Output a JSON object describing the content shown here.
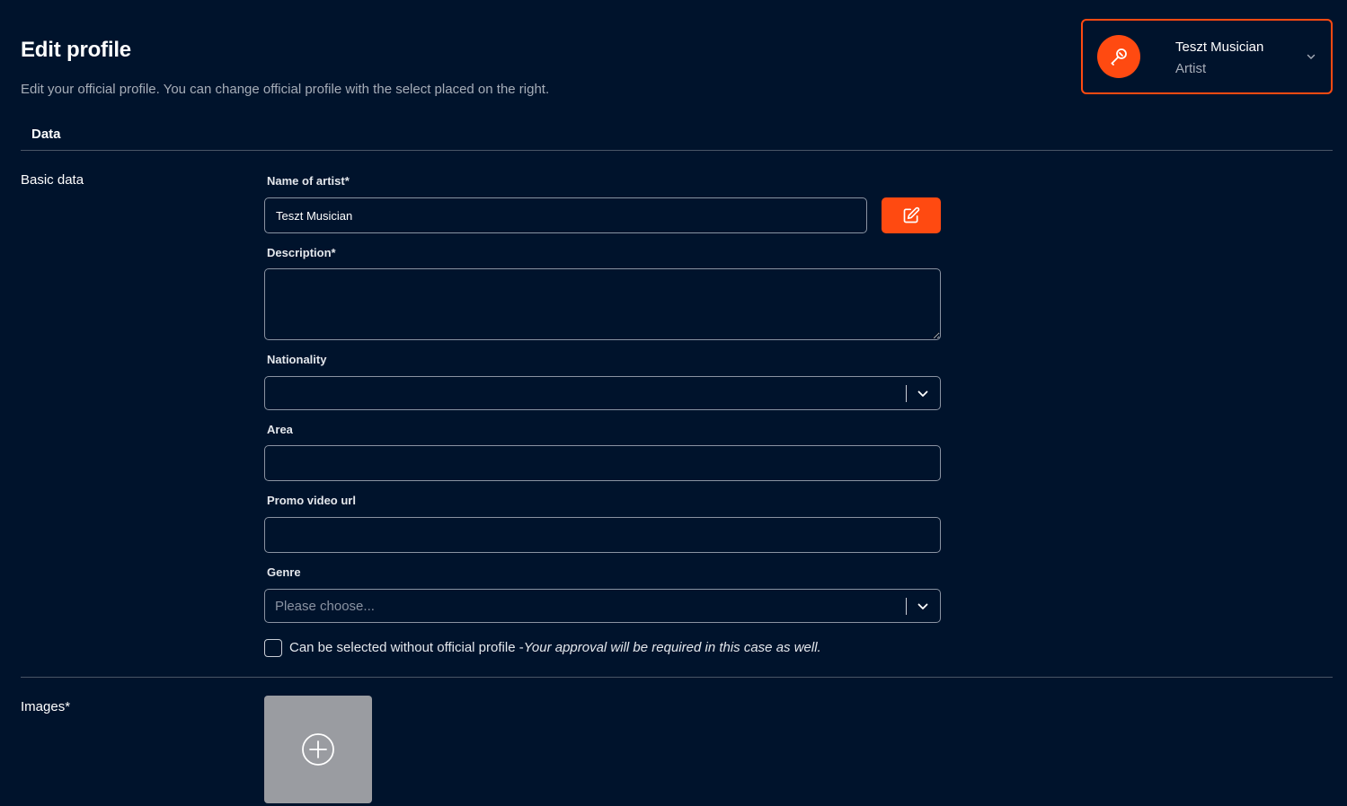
{
  "header": {
    "title": "Edit profile",
    "subtitle": "Edit your official profile. You can change official profile with the select placed on the right."
  },
  "profile_selector": {
    "name": "Teszt Musician",
    "role": "Artist",
    "avatar_icon": "microphone-icon",
    "accent_color": "#ff4a11"
  },
  "tabs": [
    {
      "label": "Data"
    }
  ],
  "sections": {
    "basic_data": "Basic data",
    "images": "Images*"
  },
  "form": {
    "name_label": "Name of artist*",
    "name_value": "Teszt Musician",
    "edit_icon": "edit-icon",
    "description_label": "Description*",
    "description_value": "",
    "nationality_label": "Nationality",
    "nationality_value": "",
    "area_label": "Area",
    "area_value": "",
    "promo_label": "Promo video url",
    "promo_value": "",
    "genre_label": "Genre",
    "genre_placeholder": "Please choose...",
    "checkbox_label": "Can be selected without official profile -",
    "checkbox_note": "Your approval will be required in this case as well.",
    "checkbox_checked": false
  },
  "images": {
    "add_icon": "plus-circle-icon"
  },
  "colors": {
    "background": "#00132c",
    "accent": "#ff4a11",
    "border": "#8a93a2"
  }
}
